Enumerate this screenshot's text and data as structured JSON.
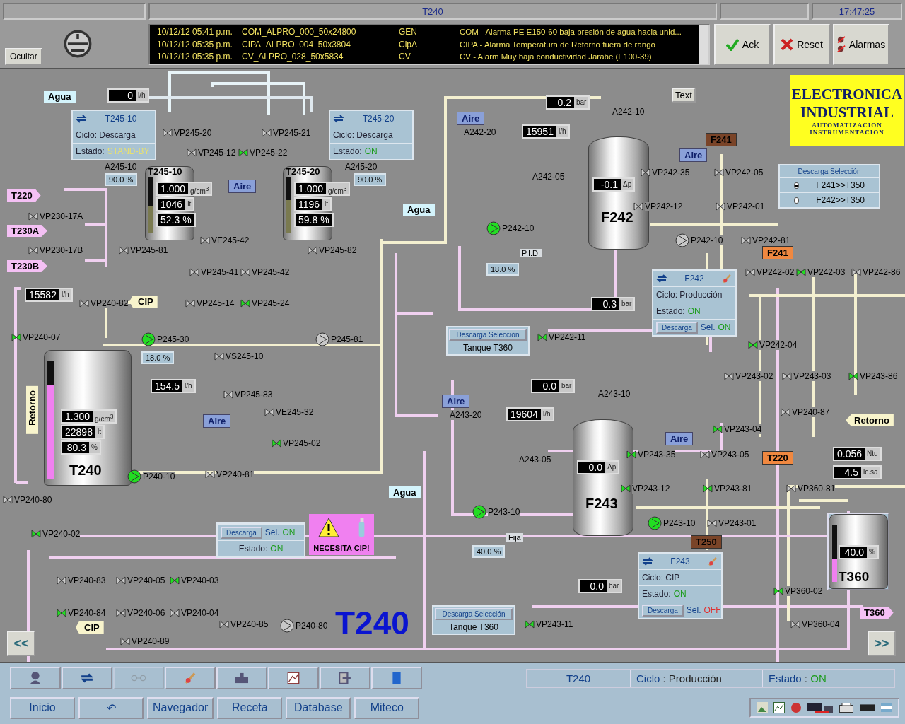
{
  "header": {
    "title": "T240",
    "time": "17:47:25",
    "hide_button": "Ocultar",
    "alarms": [
      {
        "date": "10/12/12 05:41 p.m.",
        "tag": "COM_ALPRO_000_50x24800",
        "group": "GEN",
        "message": "COM - Alarma PE E150-60 baja presión de agua hacia unid..."
      },
      {
        "date": "10/12/12 05:35 p.m.",
        "tag": "CIPA_ALPRO_004_50x3804",
        "group": "CipA",
        "message": "CIPA - Alarma Temperatura de Retorno fuera de rango"
      },
      {
        "date": "10/12/12 05:35 p.m.",
        "tag": "CV_ALPRO_028_50x5834",
        "group": "CV",
        "message": "CV - Alarm Muy baja conductividad Jarabe (E100-39)"
      }
    ],
    "buttons": [
      {
        "label": "Ack",
        "kind": "ack"
      },
      {
        "label": "Reset",
        "kind": "reset"
      },
      {
        "label": "Alarmas",
        "kind": "alarms"
      }
    ]
  },
  "diagram": {
    "tanks": [
      {
        "name": "T245-10",
        "kind": "small",
        "level": 0.5,
        "readings": [
          {
            "value": "1.000",
            "unit": "g/cm$^{3}$"
          },
          {
            "value": "1046",
            "unit": "lt"
          },
          {
            "value": "52.3 %"
          }
        ]
      },
      {
        "name": "T245-20",
        "kind": "small",
        "level": 0.6,
        "readings": [
          {
            "value": "1.000",
            "unit": "g/cm$^{3}$"
          },
          {
            "value": "1196",
            "unit": "lt"
          },
          {
            "value": "59.8 %"
          }
        ]
      },
      {
        "name": "F242",
        "kind": "ferm",
        "readings": [
          {
            "value": "-0.1",
            "unit": "Δp"
          }
        ]
      },
      {
        "name": "T240",
        "kind": "big",
        "level": 0.8,
        "readings": [
          {
            "value": "1.300",
            "unit": "g/cm$^{3}$"
          },
          {
            "value": "22898",
            "unit": "lt"
          },
          {
            "value": "80.3",
            "unit": "%"
          }
        ]
      },
      {
        "name": "F243",
        "kind": "ferm",
        "readings": [
          {
            "value": "0.0",
            "unit": "Δp"
          }
        ]
      },
      {
        "name": "T360",
        "kind": "mini",
        "level": 0.4,
        "readings": [
          {
            "value": "40.0",
            "unit": "%"
          }
        ]
      }
    ],
    "readouts": [
      {
        "value": "0",
        "unit": "l/h"
      },
      {
        "value": "0.2",
        "unit": "bar"
      },
      {
        "value": "15951",
        "unit": "l/h"
      },
      {
        "value": "15582",
        "unit": "l/h"
      },
      {
        "value": "0.3",
        "unit": "bar"
      },
      {
        "value": "154.5",
        "unit": "l/h"
      },
      {
        "value": "0.0",
        "unit": "bar"
      },
      {
        "value": "19604",
        "unit": "l/h"
      },
      {
        "value": "0.056",
        "unit": "Ntu"
      },
      {
        "value": "4.5",
        "unit": "lc.sa"
      },
      {
        "value": "0.0",
        "unit": "bar"
      }
    ],
    "setpoints": [
      "90.0 %",
      "90.0 %",
      "18.0 %",
      "18.0 %",
      "40.0 %"
    ],
    "modes": [
      "P.I.D.",
      "Fija"
    ],
    "tags": [
      {
        "text": "Agua",
        "kind": "water"
      },
      {
        "text": "Aire",
        "kind": "air"
      },
      {
        "text": "F241",
        "kind": "brown"
      },
      {
        "text": "Aire",
        "kind": "air"
      },
      {
        "text": "Aire",
        "kind": "air"
      },
      {
        "text": "T220",
        "kind": "tank-link"
      },
      {
        "text": "Agua",
        "kind": "water"
      },
      {
        "text": "T230A",
        "kind": "tank-link"
      },
      {
        "text": "F241",
        "kind": "orange"
      },
      {
        "text": "T230B",
        "kind": "tank-link"
      },
      {
        "text": "CIP",
        "kind": "cip"
      },
      {
        "text": "Retorno",
        "kind": "return-vertical"
      },
      {
        "text": "Aire",
        "kind": "air"
      },
      {
        "text": "Aire",
        "kind": "air"
      },
      {
        "text": "Retorno",
        "kind": "cip"
      },
      {
        "text": "Aire",
        "kind": "air"
      },
      {
        "text": "T220",
        "kind": "orange"
      },
      {
        "text": "Agua",
        "kind": "water"
      },
      {
        "text": "T250",
        "kind": "brown"
      },
      {
        "text": "T360",
        "kind": "tank-link"
      },
      {
        "text": "CIP",
        "kind": "cip"
      }
    ],
    "valves": [
      {
        "label": "VP245-20",
        "open": false
      },
      {
        "label": "VP245-21",
        "open": false
      },
      {
        "label": "VP245-12",
        "open": false
      },
      {
        "label": "VP245-22",
        "open": true
      },
      {
        "label": "VP242-35",
        "open": false
      },
      {
        "label": "VP242-05",
        "open": false
      },
      {
        "label": "VP242-12",
        "open": false
      },
      {
        "label": "VP242-01",
        "open": false
      },
      {
        "label": "VP230-17A",
        "open": false
      },
      {
        "label": "VE245-42",
        "open": false
      },
      {
        "label": "VP242-81",
        "open": false
      },
      {
        "label": "VP230-17B",
        "open": false
      },
      {
        "label": "VP245-81",
        "open": false
      },
      {
        "label": "VP245-82",
        "open": false
      },
      {
        "label": "VP245-41",
        "open": false
      },
      {
        "label": "VP245-42",
        "open": false
      },
      {
        "label": "VP242-02",
        "open": false
      },
      {
        "label": "VP242-03",
        "open": true
      },
      {
        "label": "VP242-86",
        "open": false
      },
      {
        "label": "VP240-82",
        "open": false
      },
      {
        "label": "VP245-14",
        "open": false
      },
      {
        "label": "VP245-24",
        "open": true
      },
      {
        "label": "VP240-07",
        "open": true
      },
      {
        "label": "VP242-11",
        "open": true
      },
      {
        "label": "VP242-04",
        "open": true
      },
      {
        "label": "VS245-10",
        "open": false
      },
      {
        "label": "VP243-02",
        "open": false
      },
      {
        "label": "VP243-03",
        "open": false
      },
      {
        "label": "VP243-86",
        "open": true
      },
      {
        "label": "VP245-83",
        "open": false
      },
      {
        "label": "VE245-32",
        "open": false
      },
      {
        "label": "VP240-87",
        "open": false
      },
      {
        "label": "VP243-04",
        "open": true
      },
      {
        "label": "VP245-02",
        "open": true
      },
      {
        "label": "VP243-35",
        "open": true
      },
      {
        "label": "VP243-05",
        "open": false
      },
      {
        "label": "VP240-81",
        "open": false
      },
      {
        "label": "VP243-12",
        "open": true
      },
      {
        "label": "VP243-81",
        "open": true
      },
      {
        "label": "VP360-81",
        "open": false
      },
      {
        "label": "VP240-80",
        "open": false
      },
      {
        "label": "VP243-01",
        "open": false
      },
      {
        "label": "VP240-02",
        "open": true
      },
      {
        "label": "VP240-83",
        "open": false
      },
      {
        "label": "VP240-05",
        "open": false
      },
      {
        "label": "VP240-03",
        "open": true
      },
      {
        "label": "VP360-02",
        "open": true
      },
      {
        "label": "VP240-84",
        "open": true
      },
      {
        "label": "VP240-06",
        "open": false
      },
      {
        "label": "VP240-04",
        "open": false
      },
      {
        "label": "VP240-85",
        "open": false
      },
      {
        "label": "VP243-11",
        "open": true
      },
      {
        "label": "VP360-04",
        "open": false
      },
      {
        "label": "VP240-89",
        "open": false
      }
    ],
    "pumps": [
      {
        "label": "P242-10",
        "running": true
      },
      {
        "label": "P242-10",
        "running": false
      },
      {
        "label": "P245-30",
        "running": true
      },
      {
        "label": "P245-81",
        "running": false
      },
      {
        "label": "P240-10",
        "running": true
      },
      {
        "label": "P243-10",
        "running": true
      },
      {
        "label": "P243-10",
        "running": true
      },
      {
        "label": "P240-80",
        "running": false
      }
    ],
    "equipment_labels": [
      "A242-10",
      "A242-20",
      "A245-10",
      "A245-20",
      "A242-05",
      "A243-10",
      "A243-20",
      "A243-05"
    ],
    "status_panels": [
      {
        "title": "T245-10",
        "cycle": "Ciclo: Descarga",
        "state_label": "Estado:",
        "state": "STAND-BY",
        "color": "#e8e070"
      },
      {
        "title": "T245-20",
        "cycle": "Ciclo: Descarga",
        "state_label": "Estado:",
        "state": "ON",
        "color": "#1c9c1c"
      },
      {
        "title": "F242",
        "cycle": "Ciclo: Producción",
        "state_label": "Estado:",
        "state": "ON",
        "color": "#1c9c1c",
        "discharge": "Descarga",
        "sel_label": "Sel.",
        "sel": "ON",
        "sel_on": true
      },
      {
        "title": "F243",
        "cycle": "Ciclo: CIP",
        "state_label": "Estado:",
        "state": "ON",
        "color": "#1c9c1c",
        "discharge": "Descarga",
        "sel_label": "Sel.",
        "sel": "OFF",
        "sel_on": false
      }
    ],
    "discharge_panels": [
      {
        "button": "Descarga Selección",
        "tank": "Tanque T360"
      },
      {
        "button": "Descarga Selección",
        "tank": "Tanque T360"
      }
    ],
    "radio_panel": {
      "title": "Descarga Selección",
      "options": [
        {
          "label": "F241>>T350",
          "selected": true
        },
        {
          "label": "F242>>T350",
          "selected": false
        }
      ]
    },
    "t240_panel": {
      "discharge": "Descarga",
      "sel_label": "Sel.",
      "sel": "ON",
      "sel_on": true,
      "state_label": "Estado:",
      "state": "ON"
    },
    "cip_warning": "NECESITA CIP!",
    "text_button": "Text",
    "logo": {
      "line1": "ELECTRONICA",
      "line2": "INDUSTRIAL",
      "line3": "AUTOMATIZACION",
      "line4": "INSTRUMENTACION"
    },
    "big_title": "T240",
    "nav": [
      "<<",
      ">>"
    ]
  },
  "footer": {
    "tool_buttons": [
      {
        "kind": "operator"
      },
      {
        "kind": "cycle"
      },
      {
        "kind": "glasses",
        "disabled": true
      },
      {
        "kind": "edit"
      },
      {
        "kind": "tray"
      },
      {
        "kind": "chart"
      },
      {
        "kind": "exit"
      },
      {
        "kind": "door"
      }
    ],
    "status": [
      {
        "text": "T240"
      },
      {
        "label": "Ciclo",
        "separator": ":",
        "value": "Producción"
      },
      {
        "label": "Estado",
        "separator": ":",
        "value": "ON"
      }
    ],
    "menu": [
      "Inicio",
      "↶",
      "Navegador",
      "Receta",
      "Database",
      "Miteco"
    ]
  }
}
